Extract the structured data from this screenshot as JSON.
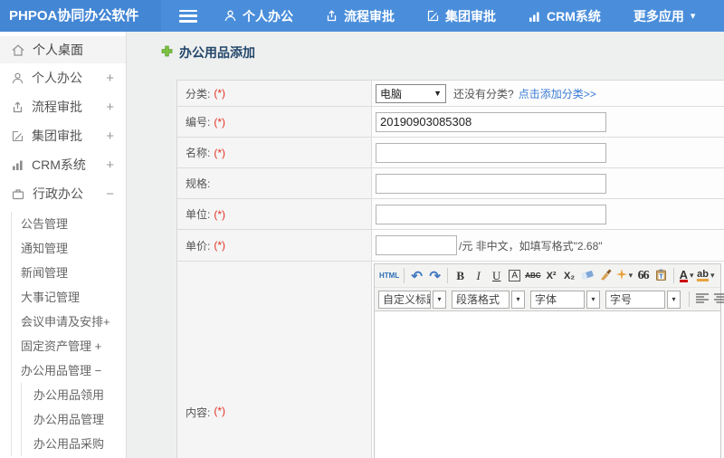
{
  "colors": {
    "topbar": "#4a8edb",
    "logo_bg": "#4386d4",
    "link": "#3a7bd5",
    "required": "#e33222",
    "title": "#24476b",
    "plus_green": "#7cc142"
  },
  "glyphs": {
    "caret": "▾",
    "select_caret": "▼",
    "undo": "↶",
    "redo": "↷"
  },
  "topbar": {
    "logo": "PHPOA协同办公软件",
    "nav": [
      {
        "label": "个人办公"
      },
      {
        "label": "流程审批"
      },
      {
        "label": "集团审批"
      },
      {
        "label": "CRM系统"
      },
      {
        "label": "更多应用"
      }
    ]
  },
  "sidebar": {
    "items": [
      {
        "label": "个人桌面",
        "expand": ""
      },
      {
        "label": "个人办公",
        "expand": "+"
      },
      {
        "label": "流程审批",
        "expand": "+"
      },
      {
        "label": "集团审批",
        "expand": "+"
      },
      {
        "label": "CRM系统",
        "expand": "+"
      },
      {
        "label": "行政办公",
        "expand": "−"
      }
    ],
    "admin_submenu": [
      {
        "label": "公告管理"
      },
      {
        "label": "通知管理"
      },
      {
        "label": "新闻管理"
      },
      {
        "label": "大事记管理"
      },
      {
        "label": "会议申请及安排+"
      },
      {
        "label": "固定资产管理 +"
      },
      {
        "label": "办公用品管理 −"
      }
    ],
    "supplies_submenu": [
      {
        "label": "办公用品领用"
      },
      {
        "label": "办公用品管理"
      },
      {
        "label": "办公用品采购"
      }
    ]
  },
  "main": {
    "title": "办公用品添加",
    "form": {
      "category": {
        "label": "分类:",
        "required": "(*)",
        "selected": "电脑",
        "hint": "还没有分类?",
        "link": "点击添加分类>>"
      },
      "code": {
        "label": "编号:",
        "required": "(*)",
        "value": "20190903085308"
      },
      "name": {
        "label": "名称:",
        "required": "(*)",
        "value": ""
      },
      "spec": {
        "label": "规格:",
        "value": ""
      },
      "unit": {
        "label": "单位:",
        "required": "(*)",
        "value": ""
      },
      "price": {
        "label": "单价:",
        "required": "(*)",
        "value": "",
        "suffix": "/元 非中文，如填写格式\"2.68\""
      },
      "content": {
        "label": "内容:",
        "required": "(*)"
      }
    },
    "editor": {
      "icons": {
        "html": "HTML",
        "bold": "B",
        "italic": "I",
        "underline": "U",
        "box_a": "A",
        "strike": "ABC",
        "sup": "X²",
        "sub": "X₂",
        "quote": "66",
        "font_color": "A",
        "highlight": "ab"
      },
      "dropdowns": [
        {
          "label": "自定义标题"
        },
        {
          "label": "段落格式"
        },
        {
          "label": "字体"
        },
        {
          "label": "字号"
        }
      ]
    }
  }
}
